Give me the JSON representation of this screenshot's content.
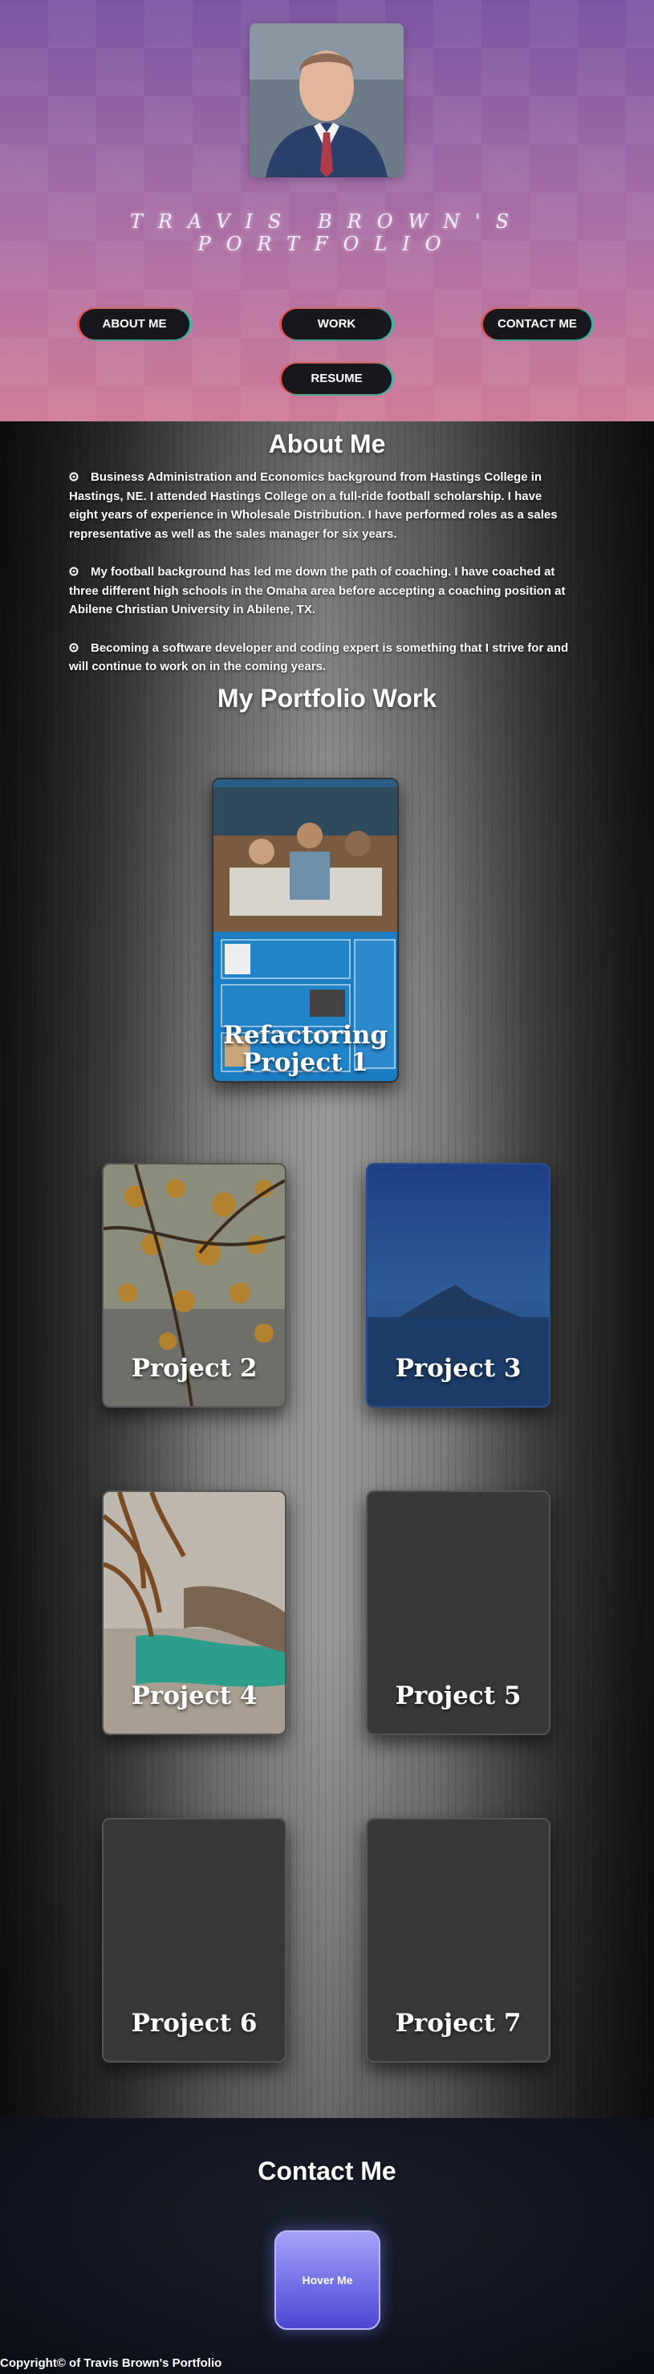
{
  "header": {
    "title": "TRAVIS BROWN'S PORTFOLIO",
    "nav": [
      {
        "label": "ABOUT ME"
      },
      {
        "label": "WORK"
      },
      {
        "label": "CONTACT ME"
      },
      {
        "label": "RESUME"
      }
    ]
  },
  "about": {
    "heading": "About Me",
    "items": [
      "Business Administration and Economics background from Hastings College in Hastings, NE. I attended Hastings College on a full-ride football scholarship. I have eight years of experience in Wholesale Distribution. I have performed roles as a sales representative as well as the sales manager for six years.",
      "My football background has led me down the path of coaching. I have coached at three different high schools in the Omaha area before accepting a coaching position at Abilene Christian University in Abilene, TX.",
      "Becoming a software developer and coding expert is something that I strive for and will continue to work on in the coming years."
    ]
  },
  "portfolio": {
    "heading": "My Portfolio Work",
    "featured": {
      "label": "Refactoring Project 1",
      "line1": "Refactoring",
      "line2": "Project 1"
    },
    "projects": [
      {
        "label": "Project 2"
      },
      {
        "label": "Project 3"
      },
      {
        "label": "Project 4"
      },
      {
        "label": "Project 5"
      },
      {
        "label": "Project 6"
      },
      {
        "label": "Project 7"
      }
    ]
  },
  "contact": {
    "heading": "Contact Me",
    "button": "Hover Me"
  },
  "footer": {
    "copyright": "Copyright© of Travis Brown's Portfolio"
  },
  "icons": {
    "avatar": "profile-photo",
    "bullet": "bullet-icon"
  },
  "colors": {
    "header_top": "#7a56a2",
    "header_bottom": "#cf7c98",
    "nav_btn_bg": "#17171d",
    "nav_border_left": "#e2514d",
    "nav_border_right": "#34b5a5",
    "contact_button": "#7270e8"
  }
}
